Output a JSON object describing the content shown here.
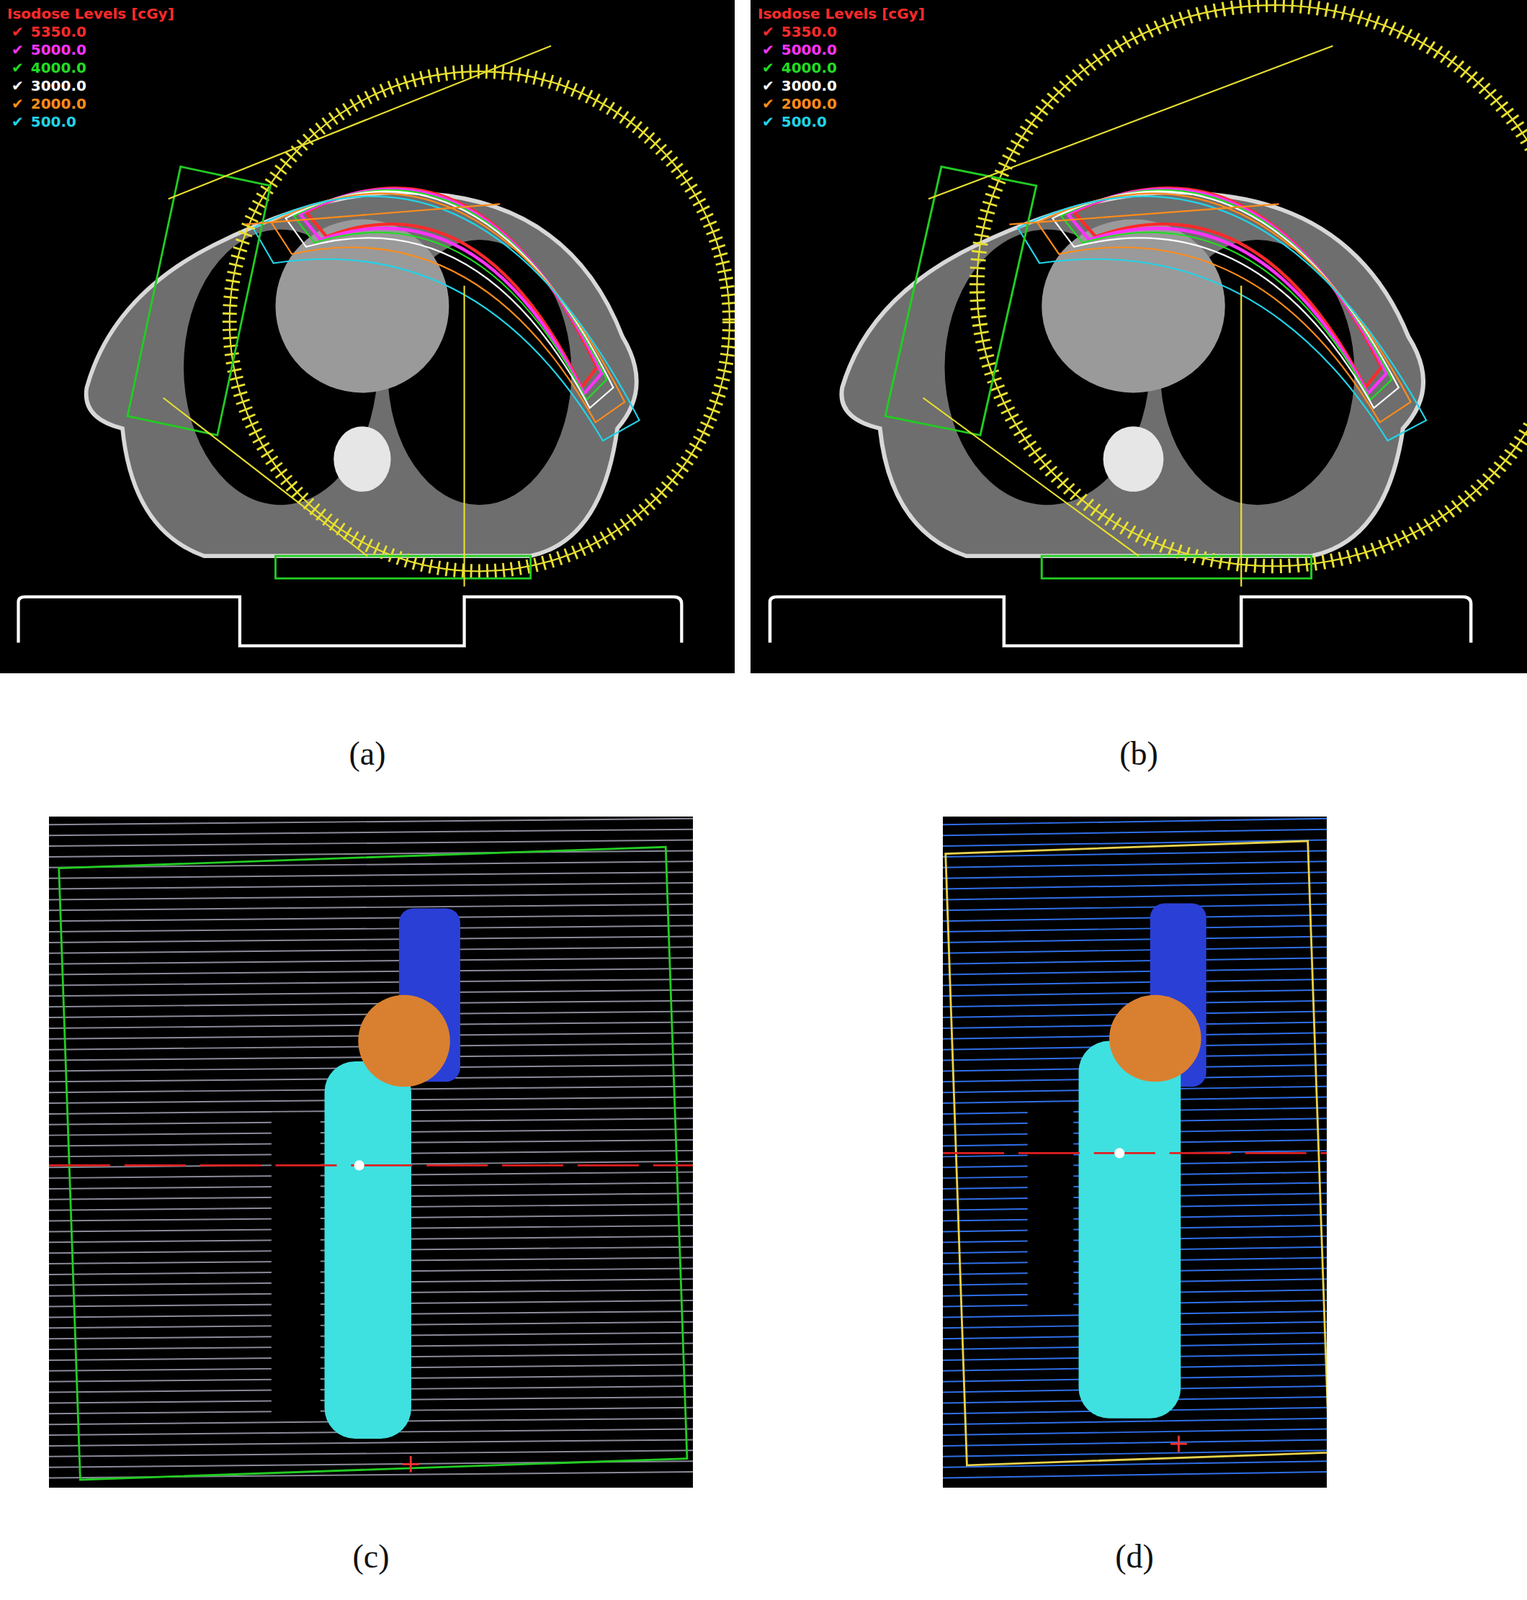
{
  "figure": {
    "top_panels": [
      {
        "caption": "(a)",
        "legend": {
          "title": "Isodose Levels [cGy]",
          "levels": [
            {
              "mark": "✔",
              "value": "5350.0",
              "checked": true,
              "color": "#ff2a2a"
            },
            {
              "mark": "✔",
              "value": "5000.0",
              "checked": true,
              "color": "#ff33ff"
            },
            {
              "mark": "✔",
              "value": "4000.0",
              "checked": true,
              "color": "#22dd22"
            },
            {
              "mark": "✔",
              "value": "3000.0",
              "checked": true,
              "color": "#ffffff"
            },
            {
              "mark": "✔",
              "value": "2000.0",
              "checked": true,
              "color": "#ff8c1a"
            },
            {
              "mark": "✔",
              "value": "500.0",
              "checked": true,
              "color": "#22d3e8"
            }
          ]
        }
      },
      {
        "caption": "(b)",
        "legend": {
          "title": "Isodose Levels [cGy]",
          "levels": [
            {
              "mark": "✔",
              "value": "5350.0",
              "checked": true,
              "color": "#ff2a2a"
            },
            {
              "mark": "✔",
              "value": "5000.0",
              "checked": true,
              "color": "#ff33ff"
            },
            {
              "mark": "✔",
              "value": "4000.0",
              "checked": true,
              "color": "#22dd22"
            },
            {
              "mark": "✔",
              "value": "3000.0",
              "checked": true,
              "color": "#ffffff"
            },
            {
              "mark": "✔",
              "value": "2000.0",
              "checked": true,
              "color": "#ff8c1a"
            },
            {
              "mark": "✔",
              "value": "500.0",
              "checked": true,
              "color": "#22d3e8"
            }
          ]
        }
      }
    ],
    "bottom_panels": [
      {
        "caption": "(c)",
        "leaf_color": "#8a8a9a",
        "frame_color": "#22cc22"
      },
      {
        "caption": "(d)",
        "leaf_color": "#2f6fe8",
        "frame_color": "#e8d24a"
      }
    ]
  }
}
